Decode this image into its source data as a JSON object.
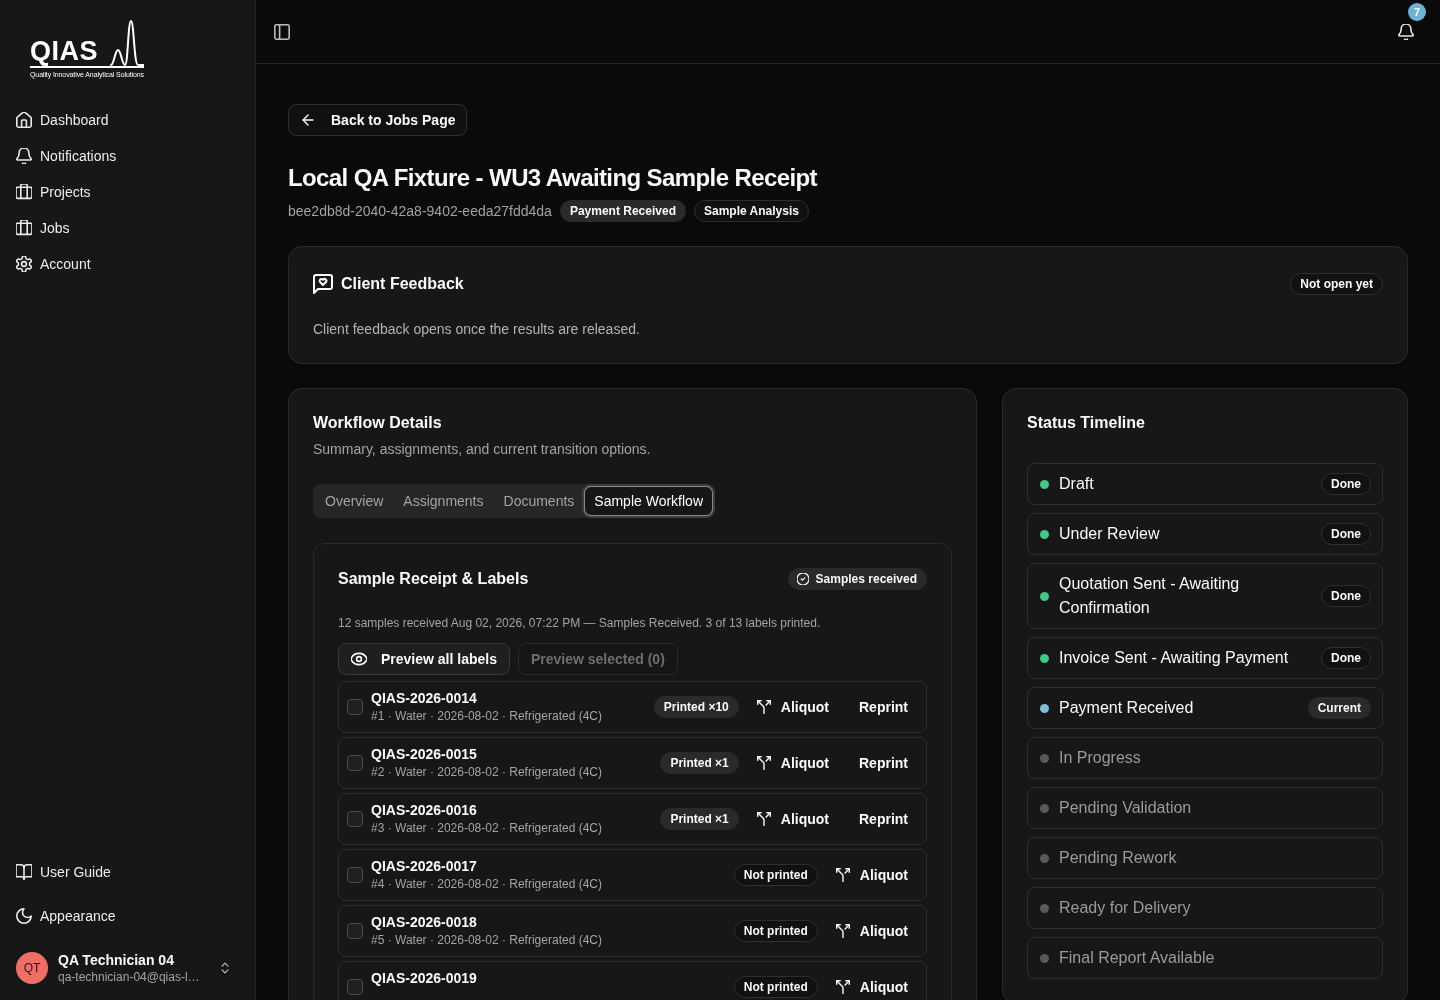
{
  "sidebar": {
    "logo": {
      "wordmark": "QIAS",
      "tagline": "Quality Innovative Analytical Solutions"
    },
    "nav": [
      {
        "label": "Dashboard"
      },
      {
        "label": "Notifications"
      },
      {
        "label": "Projects"
      },
      {
        "label": "Jobs"
      },
      {
        "label": "Account"
      }
    ],
    "footer_links": [
      {
        "label": "User Guide"
      },
      {
        "label": "Appearance"
      }
    ],
    "user": {
      "initials": "QT",
      "name": "QA Technician 04",
      "email": "qa-technician-04@qias-l…"
    }
  },
  "header": {
    "notification_count": "7"
  },
  "job": {
    "back_button": "Back to Jobs Page",
    "title": "Local QA Fixture - WU3 Awaiting Sample Receipt",
    "id": "bee2db8d-2040-42a8-9402-eeda27fdd4da",
    "badges": [
      {
        "label": "Payment Received",
        "kind": "filled"
      },
      {
        "label": "Sample Analysis",
        "kind": "outline"
      }
    ]
  },
  "client_feedback": {
    "title": "Client Feedback",
    "status": "Not open yet",
    "message": "Client feedback opens once the results are released."
  },
  "workflow": {
    "title": "Workflow Details",
    "subtitle": "Summary, assignments, and current transition options.",
    "tabs": [
      {
        "label": "Overview",
        "selected": false
      },
      {
        "label": "Assignments",
        "selected": false
      },
      {
        "label": "Documents",
        "selected": false
      },
      {
        "label": "Sample Workflow",
        "selected": true
      }
    ],
    "sample_receipt": {
      "title": "Sample Receipt & Labels",
      "status": "Samples received",
      "summary": "12 samples received Aug 02, 2026, 07:22 PM — Samples Received. 3 of 13 labels printed.",
      "actions": [
        {
          "label": "Preview all labels",
          "disabled": false
        },
        {
          "label": "Preview selected (0)",
          "disabled": true
        }
      ],
      "samples": [
        {
          "id": "QIAS-2026-0014",
          "meta": "#1 · Water · 2026-08-02 · Refrigerated (4C)",
          "checked": false,
          "print_status": "Printed ×10",
          "printed": true,
          "aliquot": "Aliquot",
          "reprint": "Reprint"
        },
        {
          "id": "QIAS-2026-0015",
          "meta": "#2 · Water · 2026-08-02 · Refrigerated (4C)",
          "checked": false,
          "print_status": "Printed ×1",
          "printed": true,
          "aliquot": "Aliquot",
          "reprint": "Reprint"
        },
        {
          "id": "QIAS-2026-0016",
          "meta": "#3 · Water · 2026-08-02 · Refrigerated (4C)",
          "checked": false,
          "print_status": "Printed ×1",
          "printed": true,
          "aliquot": "Aliquot",
          "reprint": "Reprint"
        },
        {
          "id": "QIAS-2026-0017",
          "meta": "#4 · Water · 2026-08-02 · Refrigerated (4C)",
          "checked": false,
          "print_status": "Not printed",
          "printed": false,
          "aliquot": "Aliquot"
        },
        {
          "id": "QIAS-2026-0018",
          "meta": "#5 · Water · 2026-08-02 · Refrigerated (4C)",
          "checked": false,
          "print_status": "Not printed",
          "printed": false,
          "aliquot": "Aliquot"
        },
        {
          "id": "QIAS-2026-0019",
          "checked": false,
          "print_status": "Not printed",
          "printed": false,
          "aliquot": "Aliquot"
        }
      ]
    }
  },
  "timeline": {
    "title": "Status Timeline",
    "items": [
      {
        "label": "Draft",
        "kind": "done",
        "badge": "Done",
        "color": "#3ec98b"
      },
      {
        "label": "Under Review",
        "kind": "done",
        "badge": "Done",
        "color": "#3ec98b"
      },
      {
        "label": "Quotation Sent - Awaiting Confirmation",
        "kind": "done",
        "badge": "Done",
        "color": "#3ec98b"
      },
      {
        "label": "Invoice Sent - Awaiting Payment",
        "kind": "done",
        "badge": "Done",
        "color": "#3ec98b"
      },
      {
        "label": "Payment Received",
        "kind": "current",
        "badge": "Current",
        "color": "#7dc0e0"
      },
      {
        "label": "In Progress",
        "kind": "pending",
        "color": "#5a5a5a"
      },
      {
        "label": "Pending Validation",
        "kind": "pending",
        "color": "#5a5a5a"
      },
      {
        "label": "Pending Rework",
        "kind": "pending",
        "color": "#5a5a5a"
      },
      {
        "label": "Ready for Delivery",
        "kind": "pending",
        "color": "#5a5a5a"
      },
      {
        "label": "Final Report Available",
        "kind": "pending",
        "color": "#5a5a5a"
      }
    ]
  }
}
